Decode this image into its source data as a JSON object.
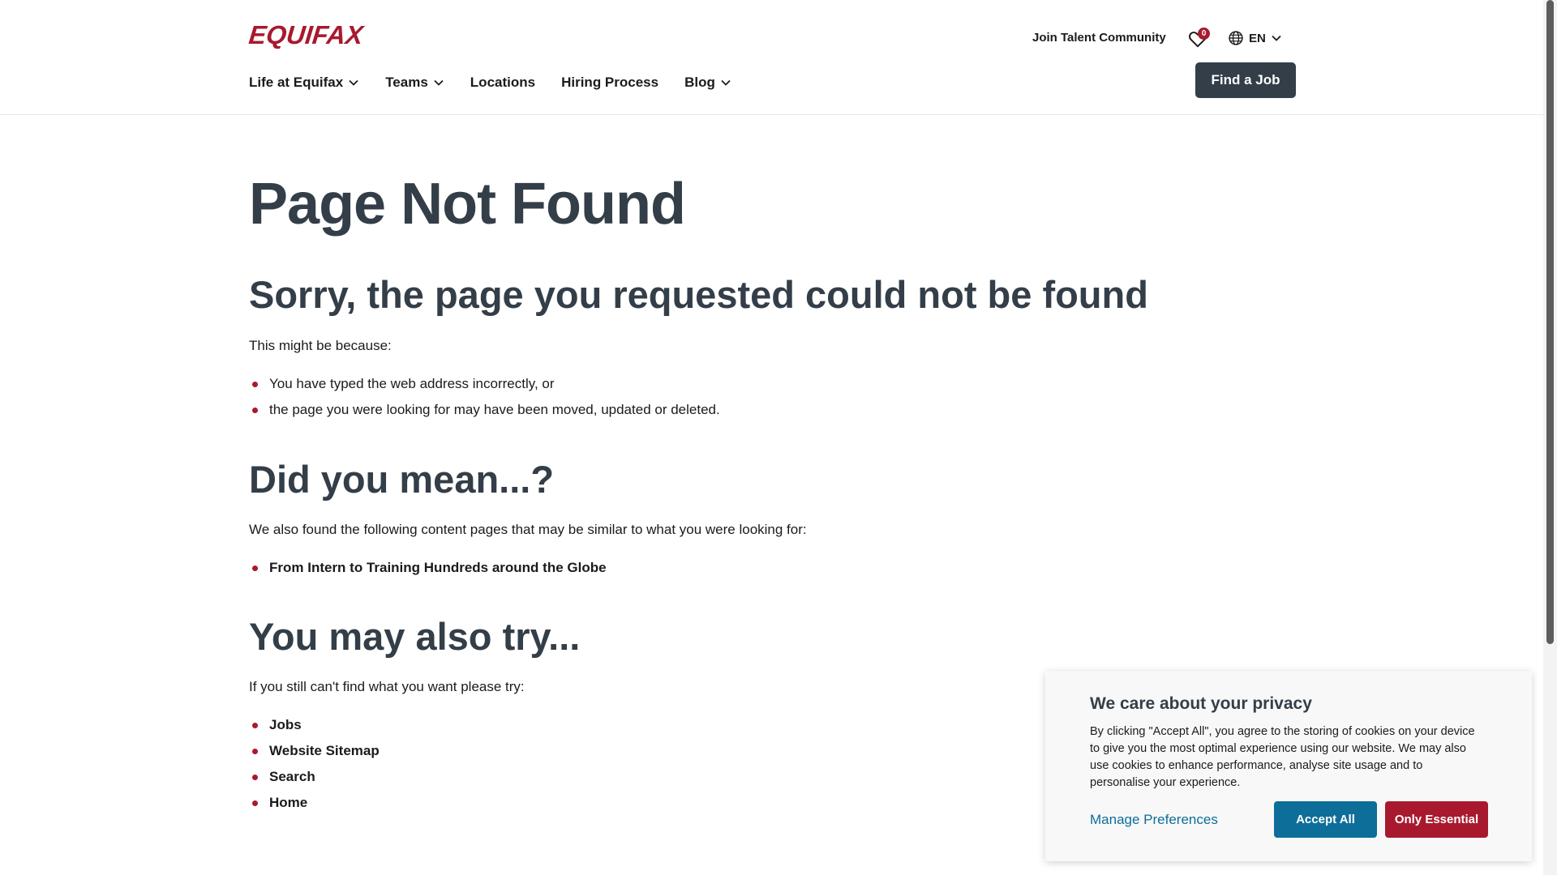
{
  "header": {
    "logo_text": "EQUIFAX",
    "join_label": "Join Talent Community",
    "saved_count": "0",
    "language": "EN",
    "find_job_label": "Find a Job",
    "nav": [
      {
        "label": "Life at Equifax",
        "has_dropdown": true
      },
      {
        "label": "Teams",
        "has_dropdown": true
      },
      {
        "label": "Locations",
        "has_dropdown": false
      },
      {
        "label": "Hiring Process",
        "has_dropdown": false
      },
      {
        "label": "Blog",
        "has_dropdown": true
      }
    ]
  },
  "main": {
    "title": "Page Not Found",
    "sorry_heading": "Sorry, the page you requested could not be found",
    "reason_intro": "This might be because:",
    "reasons": [
      "You have typed the web address incorrectly, or",
      "the page you were looking for may have been moved, updated or deleted."
    ],
    "did_you_mean_heading": "Did you mean...?",
    "similar_intro": "We also found the following content pages that may be similar to what you were looking for:",
    "similar_links": [
      "From Intern to Training Hundreds around the Globe"
    ],
    "also_try_heading": "You may also try...",
    "try_intro": "If you still can't find what you want please try:",
    "try_links": [
      "Jobs",
      "Website Sitemap",
      "Search",
      "Home"
    ]
  },
  "cookie": {
    "title": "We care about your privacy",
    "text": "By clicking \"Accept All\", you agree to the storing of cookies on your device to give you the most optimal experience using our website. We may also use cookies to enhance performance, analyse site usage and to personalise your experience.",
    "manage_label": "Manage Preferences",
    "accept_label": "Accept All",
    "essential_label": "Only Essential"
  },
  "colors": {
    "brand_red": "#a8192e",
    "heading_slate": "#333e48",
    "link_blue": "#0d6e9a"
  },
  "icons": [
    "heart-icon",
    "globe-icon",
    "chevron-down-icon"
  ]
}
